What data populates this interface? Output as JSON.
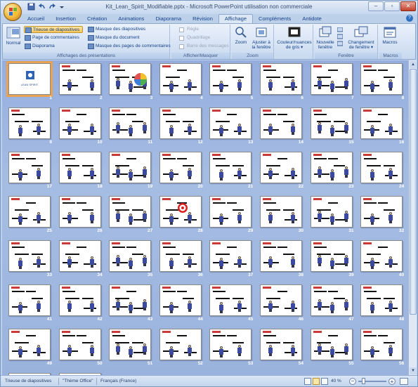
{
  "window": {
    "title": "Kit_Lean_Spirit_Modifiable.pptx - Microsoft PowerPoint utilisation non commerciale"
  },
  "tabs": [
    "Accueil",
    "Insertion",
    "Création",
    "Animations",
    "Diaporama",
    "Révision",
    "Affichage",
    "Compléments",
    "Antidote"
  ],
  "active_tab": "Affichage",
  "ribbon": {
    "presentations": {
      "normal": "Normal",
      "trieuse": "Trieuse de diapositives",
      "page_commentaires": "Page de commentaires",
      "diaporama": "Diaporama",
      "masque_diapos": "Masque des diapositives",
      "masque_document": "Masque du document",
      "masque_pages": "Masque des pages de commentaires",
      "label": "Affichages des présentations"
    },
    "afficher": {
      "regle": "Règle",
      "quadrillage": "Quadrillage",
      "barre_messages": "Barre des messages",
      "label": "Afficher/Masquer"
    },
    "zoom": {
      "zoom": "Zoom",
      "ajuster_1": "Ajuster à",
      "ajuster_2": "la fenêtre",
      "label": "Zoom"
    },
    "couleur": {
      "line1": "Couleur/nuances",
      "line2": "de gris"
    },
    "fenetre": {
      "nouvelle_1": "Nouvelle",
      "nouvelle_2": "fenêtre",
      "changement_1": "Changement",
      "changement_2": "de fenêtre",
      "label": "Fenêtre"
    },
    "macros": {
      "button": "Macros",
      "label": "Macros"
    }
  },
  "slide_numbers": [
    "1",
    "2",
    "3",
    "4",
    "5",
    "6",
    "7",
    "8",
    "9",
    "10",
    "11",
    "12",
    "13",
    "14",
    "15",
    "16",
    "17",
    "18",
    "19",
    "20",
    "21",
    "22",
    "23",
    "24",
    "25",
    "26",
    "27",
    "28",
    "29",
    "30",
    "31",
    "32",
    "33",
    "34",
    "35",
    "36",
    "37",
    "38",
    "39",
    "40",
    "41",
    "42",
    "43",
    "44",
    "45",
    "46",
    "47",
    "48",
    "49",
    "50",
    "51",
    "52",
    "53",
    "54",
    "55",
    "56"
  ],
  "first_slide_text": "LEAN SPIRIT",
  "status": {
    "view": "Trieuse de diapositives",
    "theme": "\"Thème Office\"",
    "language": "Français (France)",
    "zoom": "40 %"
  },
  "colors": {
    "accent": "#e8a254",
    "ribbon_text": "#15428b",
    "background": "#9ab3de"
  }
}
